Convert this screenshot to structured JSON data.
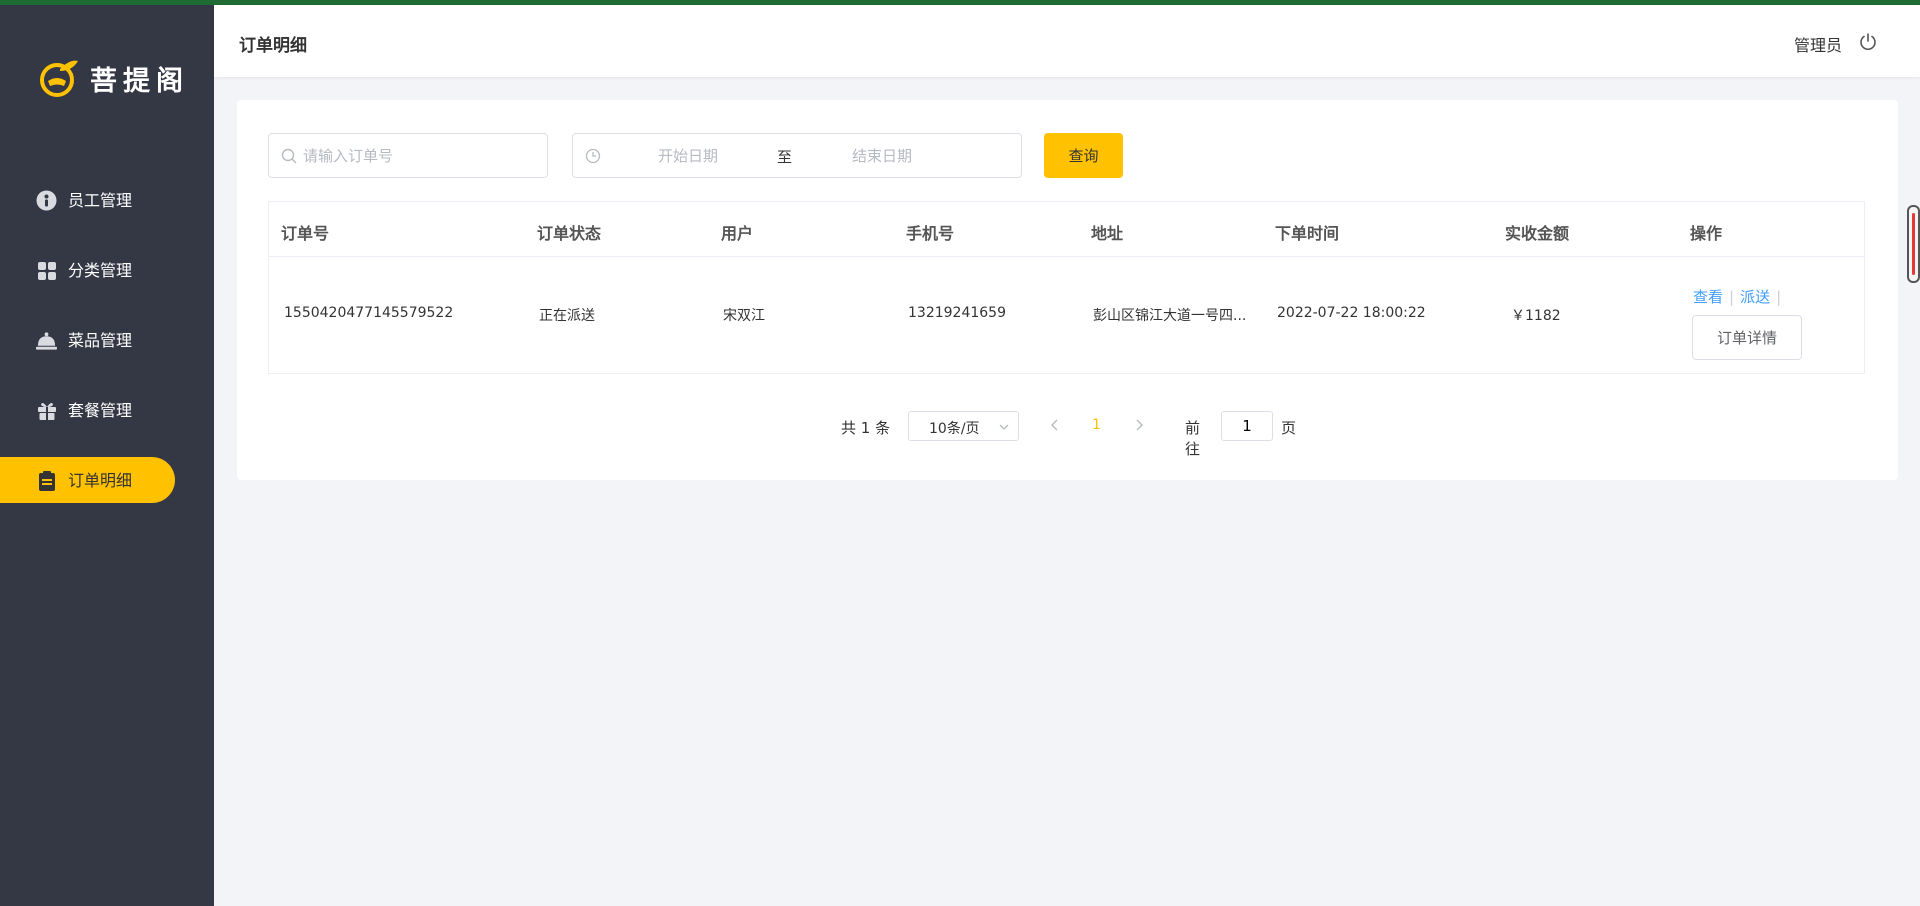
{
  "app": {
    "brand": "菩提阁"
  },
  "colors": {
    "accent": "#ffc100",
    "sidebar": "#343744",
    "link": "#409eff"
  },
  "sidebar": {
    "items": [
      {
        "label": "员工管理",
        "icon": "employee-icon"
      },
      {
        "label": "分类管理",
        "icon": "category-grid-icon"
      },
      {
        "label": "菜品管理",
        "icon": "dish-cloche-icon"
      },
      {
        "label": "套餐管理",
        "icon": "gift-icon"
      },
      {
        "label": "订单明细",
        "icon": "clipboard-icon",
        "active": true
      }
    ]
  },
  "header": {
    "title": "订单明细",
    "user": "管理员"
  },
  "filters": {
    "order_placeholder": "请输入订单号",
    "start_placeholder": "开始日期",
    "end_placeholder": "结束日期",
    "separator": "至",
    "query_label": "查询"
  },
  "table": {
    "columns": [
      "订单号",
      "订单状态",
      "用户",
      "手机号",
      "地址",
      "下单时间",
      "实收金额",
      "操作"
    ],
    "rows": [
      {
        "order_no": "1550420477145579522",
        "status": "正在派送",
        "user": "宋双江",
        "phone": "13219241659",
        "address": "彭山区锦江大道一号四...",
        "time": "2022-07-22 18:00:22",
        "amount": "￥1182",
        "actions": {
          "view": "查看",
          "dispatch": "派送",
          "detail": "订单详情"
        }
      }
    ]
  },
  "pagination": {
    "total_text": "共 1 条",
    "page_size": "10条/页",
    "current_page": "1",
    "goto_label": "前往",
    "goto_value": "1",
    "page_unit": "页"
  }
}
